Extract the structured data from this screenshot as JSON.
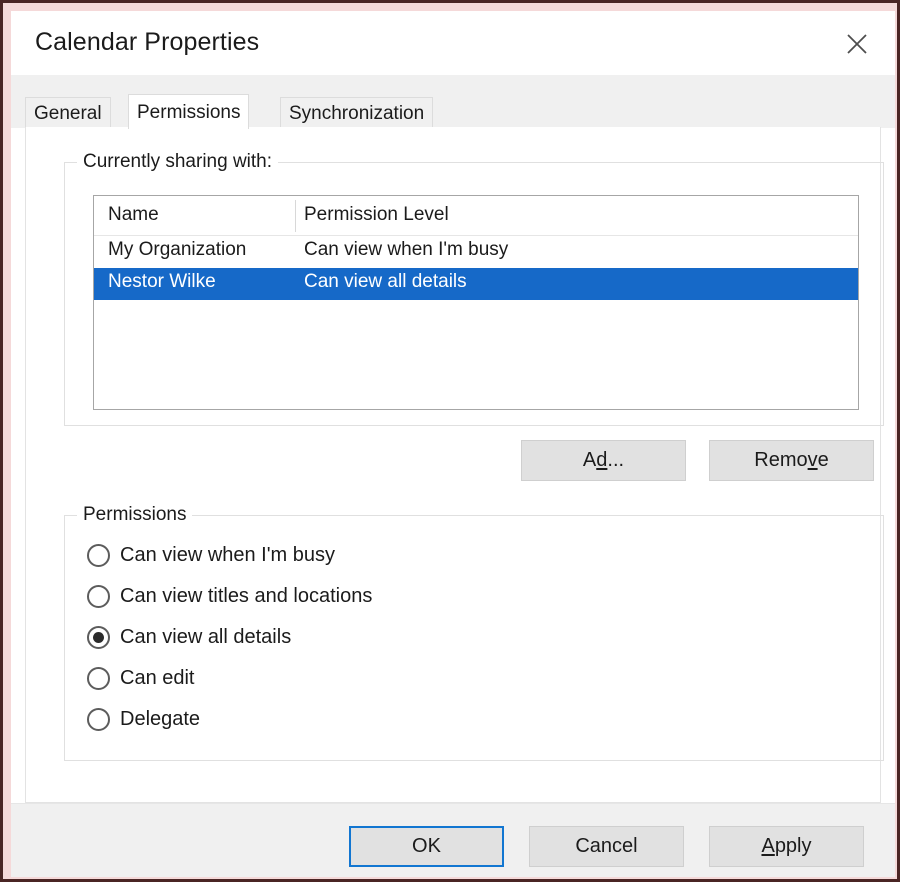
{
  "window": {
    "title": "Calendar Properties",
    "close_icon": "close-icon"
  },
  "tabs": [
    {
      "label": "General",
      "active": false
    },
    {
      "label": "Permissions",
      "active": true
    },
    {
      "label": "Synchronization",
      "active": false
    }
  ],
  "sharing_group": {
    "legend": "Currently sharing with:",
    "columns": [
      "Name",
      "Permission Level"
    ],
    "rows": [
      {
        "name": "My Organization",
        "level": "Can view when I'm busy",
        "selected": false
      },
      {
        "name": "Nestor Wilke",
        "level": "Can view all details",
        "selected": true
      }
    ],
    "buttons": {
      "add": {
        "before": "A",
        "accel": "d",
        "after": "d..."
      },
      "remove": {
        "before": "Remo",
        "accel": "v",
        "after": "e"
      }
    }
  },
  "permissions_group": {
    "legend": "Permissions",
    "options": [
      {
        "label": "Can view when I'm busy",
        "checked": false
      },
      {
        "label": "Can view titles and locations",
        "checked": false
      },
      {
        "label": "Can view all details",
        "checked": true
      },
      {
        "label": "Can edit",
        "checked": false
      },
      {
        "label": "Delegate",
        "checked": false
      }
    ]
  },
  "footer": {
    "ok": "OK",
    "cancel": "Cancel",
    "apply": {
      "accel": "A",
      "after": "pply"
    }
  },
  "colors": {
    "selection_blue": "#1669c8",
    "focus_blue": "#1276d1",
    "frame_border": "#4a2524",
    "dialog_bg": "#ffffff",
    "chrome_gray": "#f0f0f0",
    "button_face": "#e1e1e1"
  }
}
